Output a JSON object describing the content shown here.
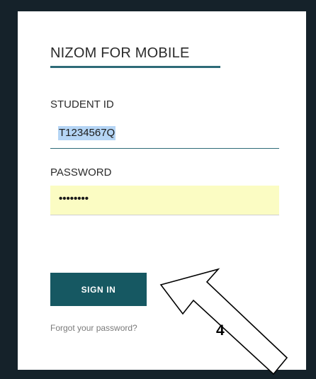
{
  "app": {
    "title": "NIZOM FOR MOBILE"
  },
  "form": {
    "student_id_label": "STUDENT ID",
    "student_id_value": "T1234567Q",
    "password_label": "PASSWORD",
    "password_value": "••••••••",
    "sign_in_label": "SIGN IN",
    "forgot_label": "Forgot your password?"
  },
  "annotation": {
    "step_number": "4",
    "arrow_icon": "outline-arrow-icon"
  },
  "colors": {
    "frame": "#15222a",
    "accent": "#2e6b78",
    "button": "#165862",
    "autofill": "#fbfcc3",
    "selection": "#b5d5f5"
  }
}
